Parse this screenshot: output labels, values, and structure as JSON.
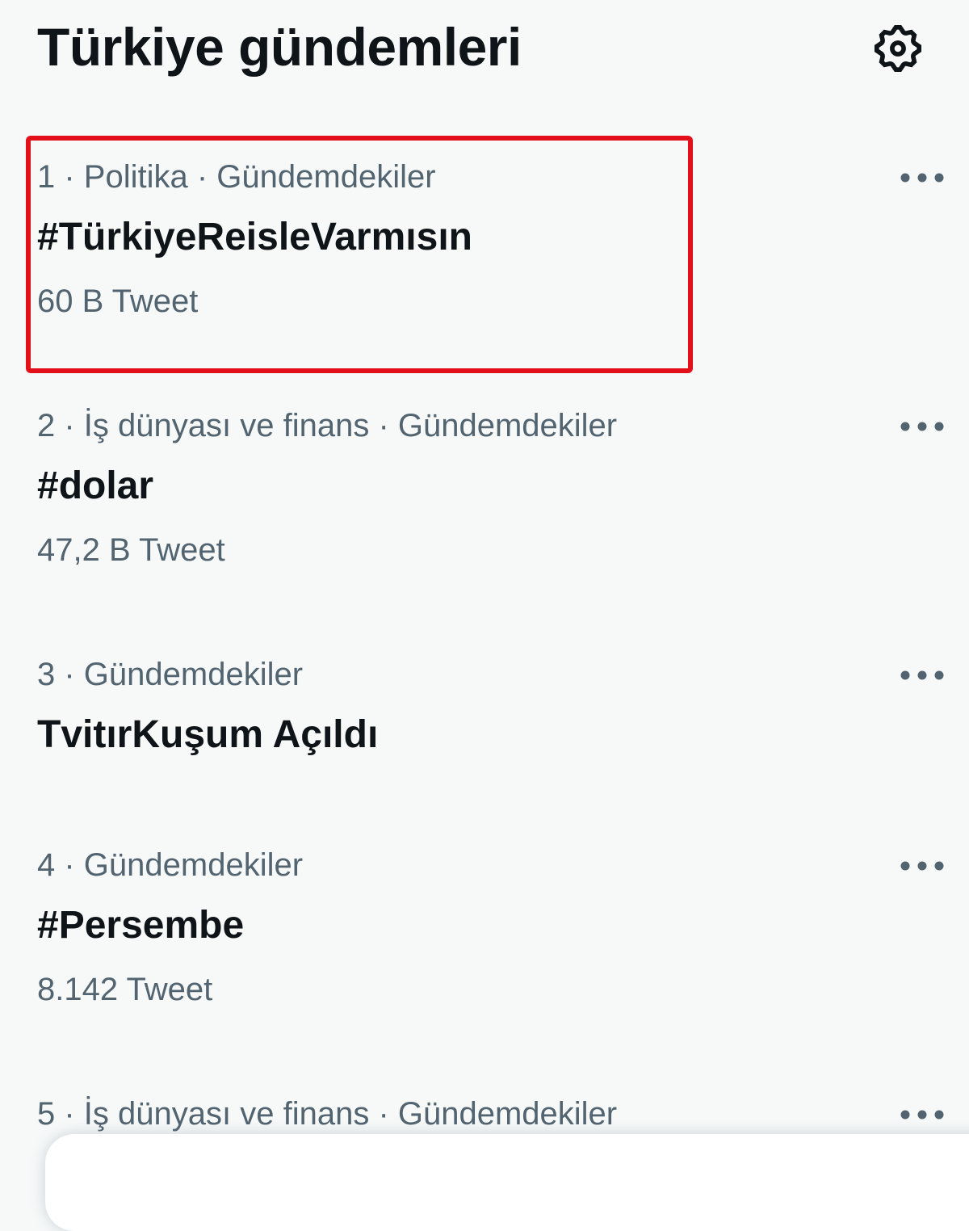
{
  "header": {
    "title": "Türkiye gündemleri",
    "settings_icon": "gear-icon"
  },
  "trends": [
    {
      "meta": "1 · Politika · Gündemdekiler",
      "name": "#TürkiyeReisleVarmısın",
      "count": "60 B Tweet",
      "highlighted": true
    },
    {
      "meta": "2 · İş dünyası ve finans · Gündemdekiler",
      "name": "#dolar",
      "count": "47,2 B Tweet"
    },
    {
      "meta": "3 · Gündemdekiler",
      "name": "TvitırKuşum Açıldı"
    },
    {
      "meta": "4 · Gündemdekiler",
      "name": "#Persembe",
      "count": "8.142 Tweet"
    },
    {
      "meta": "5 · İş dünyası ve finans · Gündemdekiler"
    }
  ],
  "more_icon": "more-horizontal-icon",
  "colors": {
    "background": "#f7f9f9",
    "primary_text": "#0f1419",
    "secondary_text": "#536471",
    "highlight_border": "#e3101a"
  }
}
